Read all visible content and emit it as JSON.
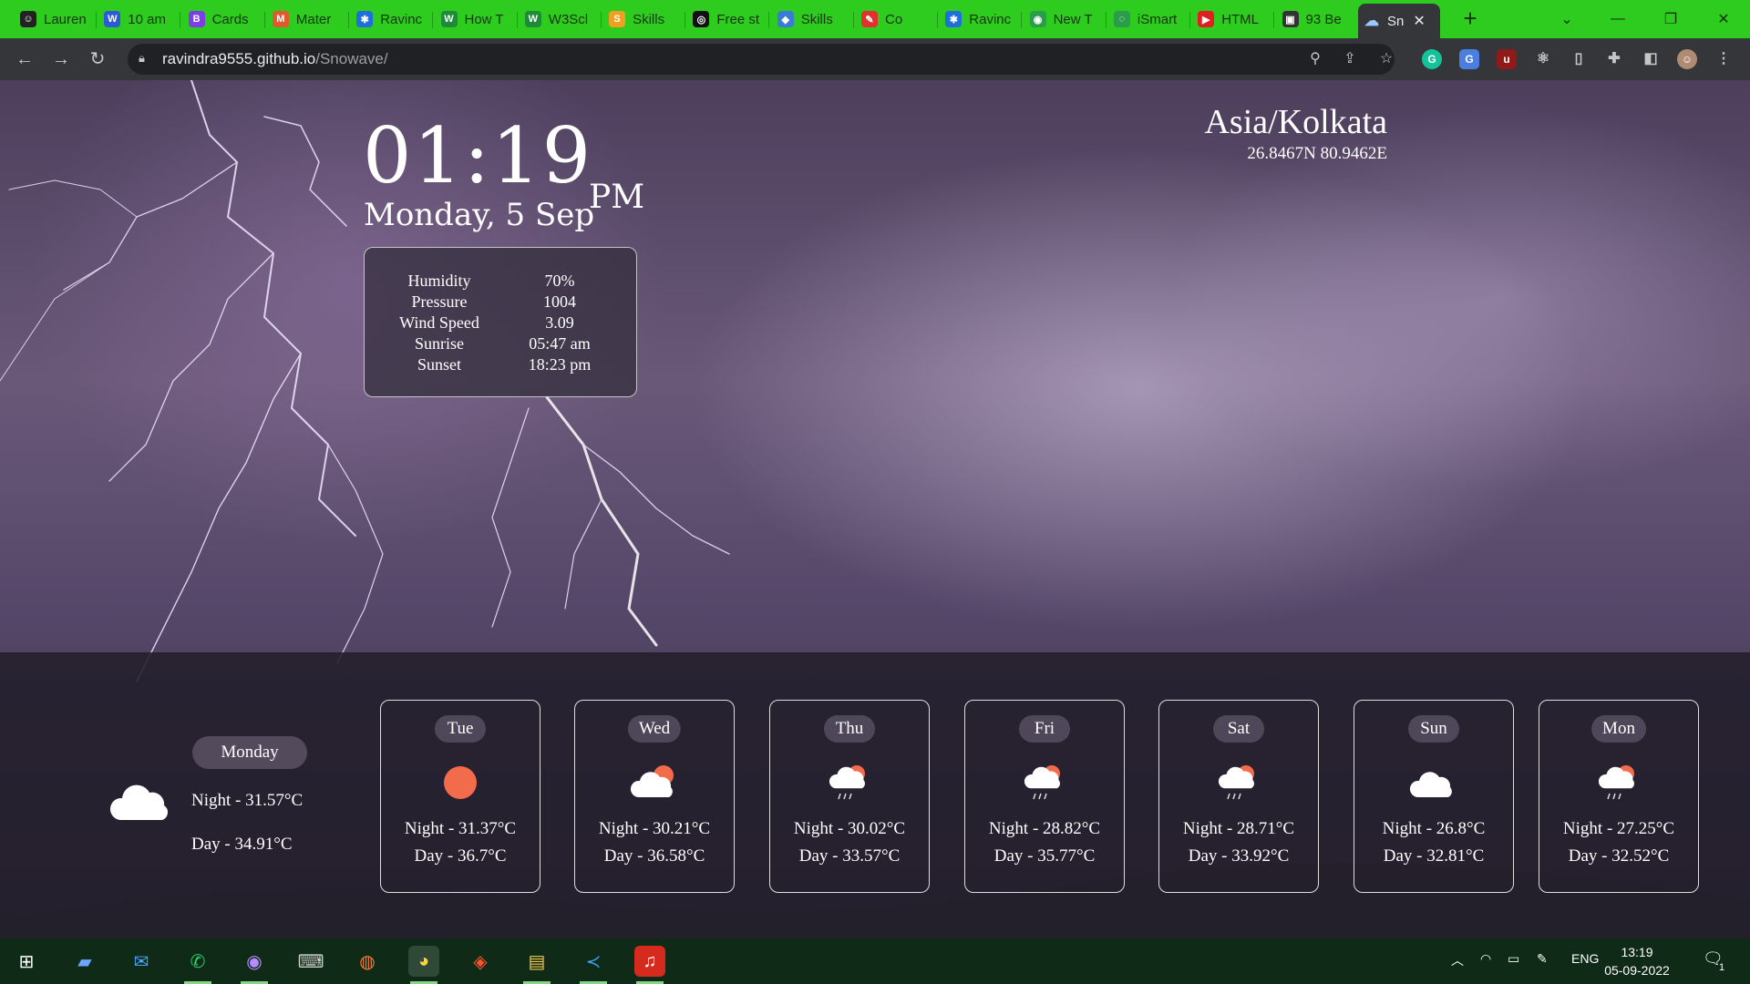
{
  "browser": {
    "tabs": [
      {
        "label": "Lauren",
        "fav_color": "#222222",
        "fav_glyph": "☺"
      },
      {
        "label": "10 am",
        "fav_color": "#2b5cd6",
        "fav_glyph": "W"
      },
      {
        "label": "Cards",
        "fav_color": "#7b3fe4",
        "fav_glyph": "B"
      },
      {
        "label": "Mater",
        "fav_color": "#e05a2b",
        "fav_glyph": "M"
      },
      {
        "label": "Ravinc",
        "fav_color": "#1e6fd9",
        "fav_glyph": "✱"
      },
      {
        "label": "How T",
        "fav_color": "#1f8a3a",
        "fav_glyph": "W"
      },
      {
        "label": "W3Scl",
        "fav_color": "#1f8a3a",
        "fav_glyph": "W"
      },
      {
        "label": "Skills",
        "fav_color": "#f0a020",
        "fav_glyph": "S"
      },
      {
        "label": "Free st",
        "fav_color": "#111111",
        "fav_glyph": "◎"
      },
      {
        "label": "Skills",
        "fav_color": "#3a7bd5",
        "fav_glyph": "◆"
      },
      {
        "label": "Co",
        "fav_color": "#e03030",
        "fav_glyph": "✎"
      },
      {
        "label": "Ravinc",
        "fav_color": "#1e6fd9",
        "fav_glyph": "✱"
      },
      {
        "label": "New T",
        "fav_color": "#2a9d4a",
        "fav_glyph": "◉"
      },
      {
        "label": "iSmart",
        "fav_color": "#2a9d4a",
        "fav_glyph": "◌"
      },
      {
        "label": "HTML",
        "fav_color": "#e02020",
        "fav_glyph": "▶"
      },
      {
        "label": "93 Be",
        "fav_color": "#333333",
        "fav_glyph": "▣"
      }
    ],
    "active_tab": "Sn",
    "url_host": "ravindra9555.github.io",
    "url_path": "/Snowave/"
  },
  "weather": {
    "time": "01:19",
    "ampm": "PM",
    "date": "Monday, 5 Sep",
    "timezone": "Asia/Kolkata",
    "coordinates": "26.8467N 80.9462E",
    "details": [
      {
        "label": "Humidity",
        "value": "70%"
      },
      {
        "label": "Pressure",
        "value": "1004"
      },
      {
        "label": "Wind Speed",
        "value": "3.09"
      },
      {
        "label": "Sunrise",
        "value": "05:47 am"
      },
      {
        "label": "Sunset",
        "value": "18:23 pm"
      }
    ],
    "today": {
      "day": "Monday",
      "night": "Night - 31.57°C",
      "dayt": "Day - 34.91°C",
      "icon": "cloud-icon"
    },
    "forecast": [
      {
        "day": "Tue",
        "night": "Night - 31.37°C",
        "dayt": "Day - 36.7°C",
        "icon": "sun-icon"
      },
      {
        "day": "Wed",
        "night": "Night - 30.21°C",
        "dayt": "Day - 36.58°C",
        "icon": "partly-cloudy-icon"
      },
      {
        "day": "Thu",
        "night": "Night - 30.02°C",
        "dayt": "Day - 33.57°C",
        "icon": "rain-sun-icon"
      },
      {
        "day": "Fri",
        "night": "Night - 28.82°C",
        "dayt": "Day - 35.77°C",
        "icon": "rain-sun-icon"
      },
      {
        "day": "Sat",
        "night": "Night - 28.71°C",
        "dayt": "Day - 33.92°C",
        "icon": "rain-sun-icon"
      },
      {
        "day": "Sun",
        "night": "Night - 26.8°C",
        "dayt": "Day - 32.81°C",
        "icon": "cloud-icon"
      },
      {
        "day": "Mon",
        "night": "Night - 27.25°C",
        "dayt": "Day - 32.52°C",
        "icon": "rain-sun-icon"
      }
    ]
  },
  "taskbar": {
    "lang": "ENG",
    "time": "13:19",
    "date": "05-09-2022",
    "notif_count": "1"
  },
  "colors": {
    "tabbar": "#2ecc1f",
    "chrome": "#35363a",
    "sun": "#f26b4b",
    "taskbar": "#0f2a17"
  }
}
